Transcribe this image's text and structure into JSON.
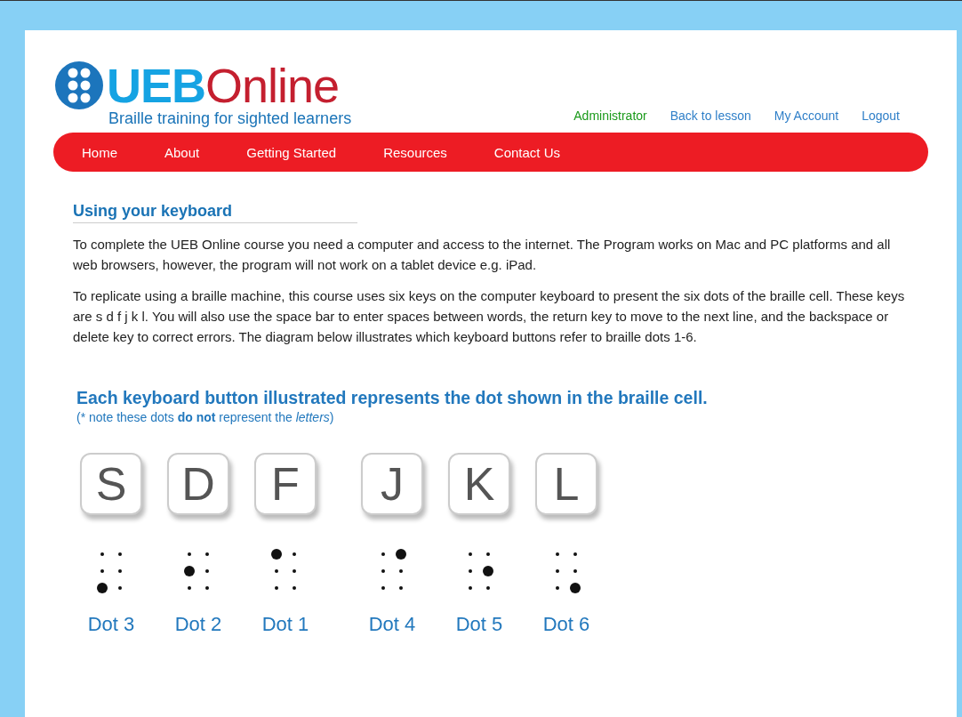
{
  "logo": {
    "brand_first": "UEB",
    "brand_second": "Online",
    "tagline": "Braille training for sighted learners"
  },
  "user_links": [
    {
      "label": "Administrator",
      "kind": "user"
    },
    {
      "label": "Back to lesson",
      "kind": "link"
    },
    {
      "label": "My Account",
      "kind": "link"
    },
    {
      "label": "Logout",
      "kind": "link"
    }
  ],
  "nav": [
    "Home",
    "About",
    "Getting Started",
    "Resources",
    "Contact Us"
  ],
  "heading": "Using your keyboard",
  "paragraphs": [
    "To complete the UEB Online course you need a computer and access to the internet. The Program works on Mac and PC platforms and all web browsers, however, the program will not work on a tablet device e.g. iPad.",
    "To replicate using a braille machine, this course uses six keys on the computer keyboard to present the six dots of the braille cell. These keys are s d f j k l. You will also use the space bar to enter spaces between words, the return key to move to the next line, and the backspace or delete key to correct errors. The diagram below illustrates which keyboard buttons refer to braille dots 1-6."
  ],
  "diagram": {
    "title": "Each keyboard button illustrated represents the dot shown in the braille cell.",
    "note": "(* note these dots **do not** represent the *letters*)",
    "keys_left": [
      {
        "letter": "S",
        "dots": [
          false,
          false,
          true,
          false,
          false,
          false
        ],
        "label": "Dot 3"
      },
      {
        "letter": "D",
        "dots": [
          false,
          true,
          false,
          false,
          false,
          false
        ],
        "label": "Dot 2"
      },
      {
        "letter": "F",
        "dots": [
          true,
          false,
          false,
          false,
          false,
          false
        ],
        "label": "Dot 1"
      }
    ],
    "keys_right": [
      {
        "letter": "J",
        "dots": [
          false,
          false,
          false,
          true,
          false,
          false
        ],
        "label": "Dot 4"
      },
      {
        "letter": "K",
        "dots": [
          false,
          false,
          false,
          false,
          true,
          false
        ],
        "label": "Dot 5"
      },
      {
        "letter": "L",
        "dots": [
          false,
          false,
          false,
          false,
          false,
          true
        ],
        "label": "Dot 6"
      }
    ]
  }
}
